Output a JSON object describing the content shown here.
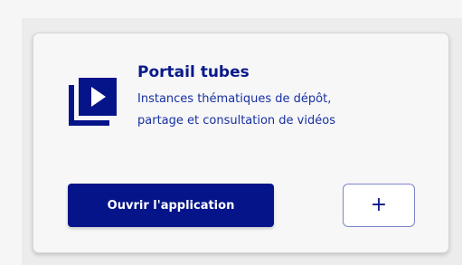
{
  "card": {
    "icon": "video-player-icon",
    "title": "Portail tubes",
    "description_line1": "Instances thématiques de dépôt,",
    "description_line2": "partage et consultation de vidéos",
    "open_button_label": "Ouvrir l'application",
    "add_button_label": "+",
    "colors": {
      "primary": "#06148a",
      "text_blue": "#1730a0",
      "card_background": "#f7f7f8"
    }
  }
}
